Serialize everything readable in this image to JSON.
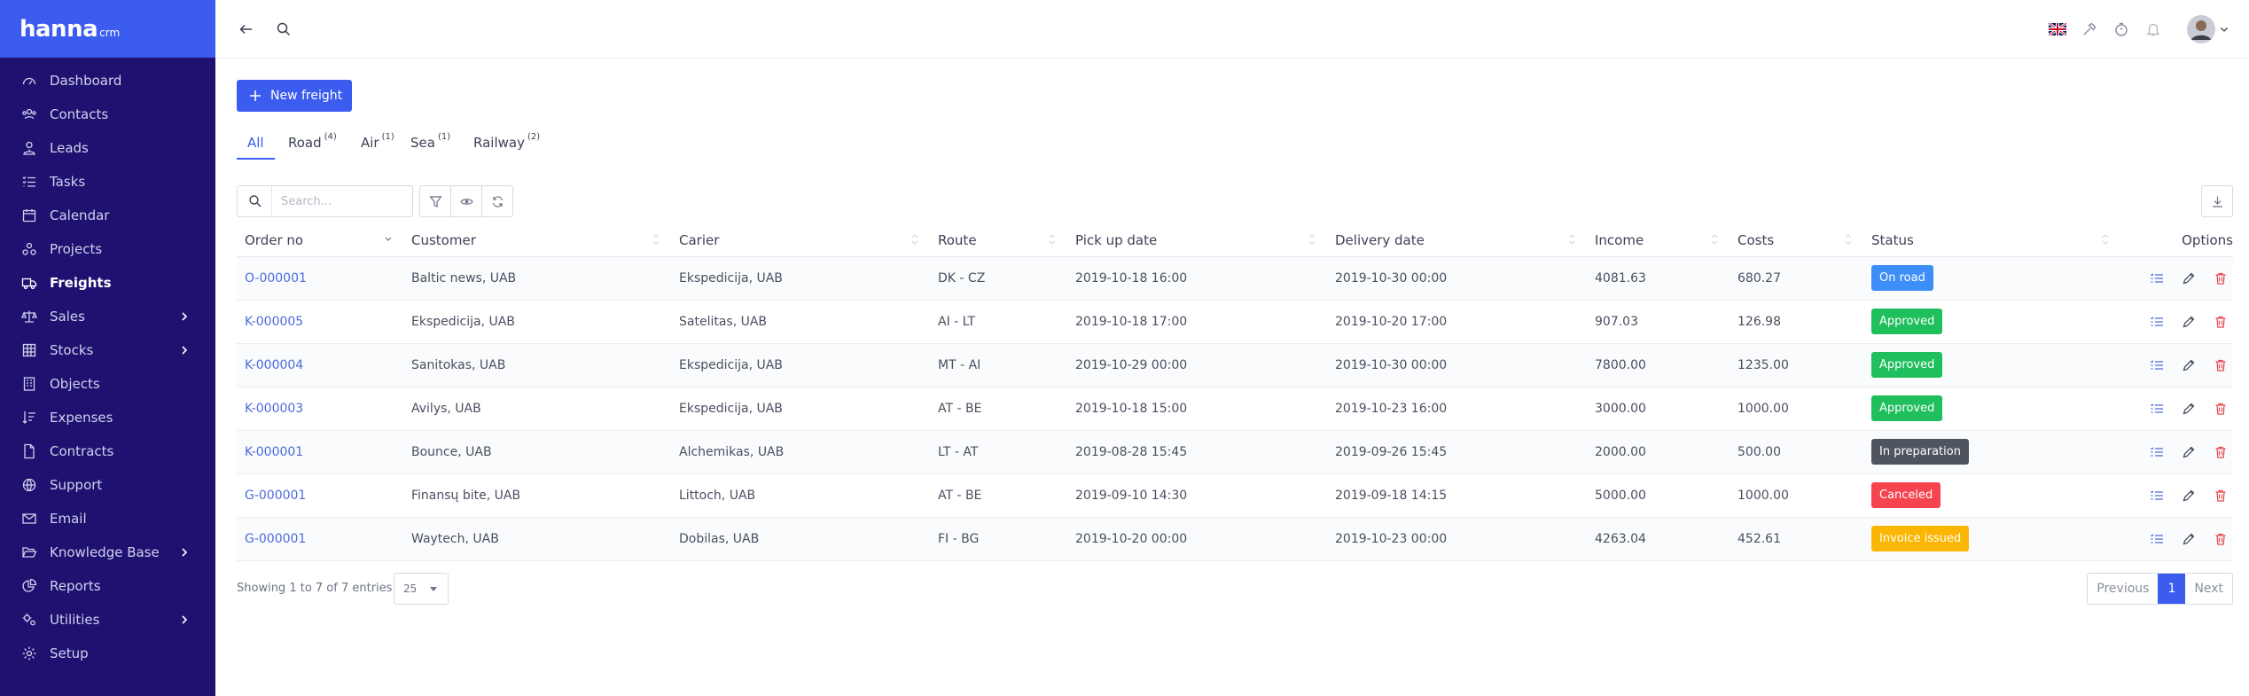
{
  "brand": {
    "name": "hanna",
    "suffix": "crm"
  },
  "sidebar": {
    "items": [
      {
        "label": "Dashboard",
        "icon": "dashboard-icon"
      },
      {
        "label": "Contacts",
        "icon": "users-icon"
      },
      {
        "label": "Leads",
        "icon": "user-tie-icon"
      },
      {
        "label": "Tasks",
        "icon": "tasks-icon"
      },
      {
        "label": "Calendar",
        "icon": "calendar-icon"
      },
      {
        "label": "Projects",
        "icon": "projects-icon"
      },
      {
        "label": "Freights",
        "icon": "truck-icon",
        "active": true
      },
      {
        "label": "Sales",
        "icon": "balance-icon",
        "has_children": true
      },
      {
        "label": "Stocks",
        "icon": "grid-icon",
        "has_children": true
      },
      {
        "label": "Objects",
        "icon": "building-icon"
      },
      {
        "label": "Expenses",
        "icon": "sort-amount-icon"
      },
      {
        "label": "Contracts",
        "icon": "document-icon"
      },
      {
        "label": "Support",
        "icon": "globe-icon"
      },
      {
        "label": "Email",
        "icon": "envelope-icon"
      },
      {
        "label": "Knowledge Base",
        "icon": "folder-open-icon",
        "has_children": true
      },
      {
        "label": "Reports",
        "icon": "pie-chart-icon"
      },
      {
        "label": "Utilities",
        "icon": "cogs-icon",
        "has_children": true
      },
      {
        "label": "Setup",
        "icon": "gear-icon"
      }
    ]
  },
  "toolbar": {
    "new_freight_label": "New freight",
    "search_placeholder": "Search..."
  },
  "tabs": [
    {
      "label": "All",
      "count": "",
      "active": true
    },
    {
      "label": "Road",
      "count": "(4)"
    },
    {
      "label": "Air",
      "count": "(1)"
    },
    {
      "label": "Sea",
      "count": "(1)"
    },
    {
      "label": "Railway",
      "count": "(2)"
    }
  ],
  "table": {
    "columns": [
      "Order no",
      "Customer",
      "Carier",
      "Route",
      "Pick up date",
      "Delivery date",
      "Income",
      "Costs",
      "Status",
      "Options"
    ],
    "rows": [
      {
        "order": "O-000001",
        "customer": "Baltic news, UAB",
        "carrier": "Ekspedicija, UAB",
        "route": "DK - CZ",
        "pickup": "2019-10-18 16:00",
        "delivery": "2019-10-30 00:00",
        "income": "4081.63",
        "costs": "680.27",
        "status": "On road",
        "status_color": "#3d8ef8"
      },
      {
        "order": "K-000005",
        "customer": "Ekspedicija, UAB",
        "carrier": "Satelitas, UAB",
        "route": "AI - LT",
        "pickup": "2019-10-18 17:00",
        "delivery": "2019-10-20 17:00",
        "income": "907.03",
        "costs": "126.98",
        "status": "Approved",
        "status_color": "#1fbf5e"
      },
      {
        "order": "K-000004",
        "customer": "Sanitokas, UAB",
        "carrier": "Ekspedicija, UAB",
        "route": "MT - AI",
        "pickup": "2019-10-29 00:00",
        "delivery": "2019-10-30 00:00",
        "income": "7800.00",
        "costs": "1235.00",
        "status": "Approved",
        "status_color": "#1fbf5e"
      },
      {
        "order": "K-000003",
        "customer": "Avilys, UAB",
        "carrier": "Ekspedicija, UAB",
        "route": "AT - BE",
        "pickup": "2019-10-18 15:00",
        "delivery": "2019-10-23 16:00",
        "income": "3000.00",
        "costs": "1000.00",
        "status": "Approved",
        "status_color": "#1fbf5e"
      },
      {
        "order": "K-000001",
        "customer": "Bounce, UAB",
        "carrier": "Alchemikas, UAB",
        "route": "LT - AT",
        "pickup": "2019-08-28 15:45",
        "delivery": "2019-09-26 15:45",
        "income": "2000.00",
        "costs": "500.00",
        "status": "In preparation",
        "status_color": "#4f555e"
      },
      {
        "order": "G-000001",
        "customer": "Finansų bite, UAB",
        "carrier": "Littoch, UAB",
        "route": "AT - BE",
        "pickup": "2019-09-10 14:30",
        "delivery": "2019-09-18 14:15",
        "income": "5000.00",
        "costs": "1000.00",
        "status": "Canceled",
        "status_color": "#f5434f"
      },
      {
        "order": "G-000001",
        "customer": "Waytech, UAB",
        "carrier": "Dobilas, UAB",
        "route": "FI - BG",
        "pickup": "2019-10-20 00:00",
        "delivery": "2019-10-23 00:00",
        "income": "4263.04",
        "costs": "452.61",
        "status": "Invoice issued",
        "status_color": "#fbb604"
      }
    ]
  },
  "footer": {
    "showing": "Showing 1 to 7 of 7 entries",
    "page_size": "25",
    "prev": "Previous",
    "current": "1",
    "next": "Next"
  },
  "colors": {
    "sidebar_bg": "#1e1170",
    "brand_bg": "#3c5cf0",
    "accent": "#3c5cf0",
    "delete": "#e5484d"
  }
}
